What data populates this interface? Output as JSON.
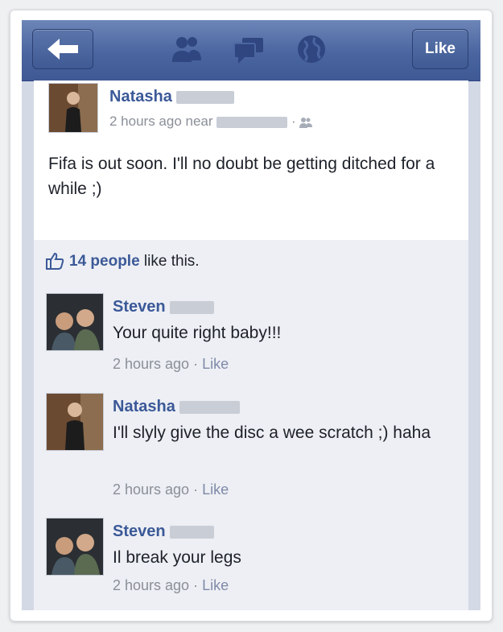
{
  "navbar": {
    "like_label": "Like",
    "icons": [
      "back-arrow-icon",
      "friends-icon",
      "messages-icon",
      "globe-icon"
    ]
  },
  "post": {
    "author": "Natasha",
    "time": "2 hours ago near",
    "text": "Fifa is out soon. I'll no doubt be getting ditched for a while ;)"
  },
  "likes": {
    "count": "14 people",
    "suffix": " like this."
  },
  "comments": [
    {
      "author": "Steven",
      "text": "Your quite right baby!!!",
      "time": "2 hours ago",
      "sep": "·",
      "like": "Like"
    },
    {
      "author": "Natasha",
      "text": "I'll slyly give the disc a wee scratch ;) haha",
      "time": "2 hours ago",
      "sep": "·",
      "like": "Like"
    },
    {
      "author": "Steven",
      "text": "Il break your legs",
      "time": "2 hours ago",
      "sep": "·",
      "like": "Like"
    }
  ],
  "colors": {
    "brand": "#3b5998",
    "navbar": "#4a65a0",
    "meta": "#8a8f98"
  }
}
